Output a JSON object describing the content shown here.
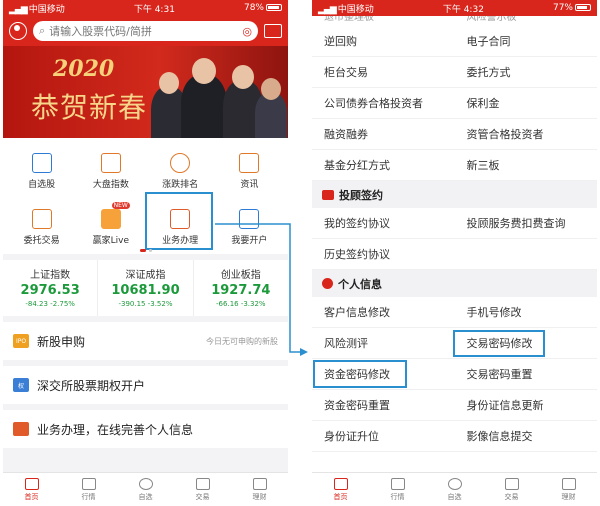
{
  "left": {
    "status": {
      "carrier": "中国移动",
      "time": "下午 4:31",
      "battery": "78%"
    },
    "search": {
      "placeholder": "请输入股票代码/简拼"
    },
    "banner": {
      "year": "2020",
      "greeting": "恭贺新春"
    },
    "grid": [
      {
        "label": "自选股",
        "icon": "chart-icon"
      },
      {
        "label": "大盘指数",
        "icon": "bar-chart-icon"
      },
      {
        "label": "涨跌排名",
        "icon": "ribbon-icon"
      },
      {
        "label": "资讯",
        "icon": "document-icon"
      },
      {
        "label": "委托交易",
        "icon": "trade-icon"
      },
      {
        "label": "赢家Live",
        "icon": "live-video-icon",
        "badge": "NEW"
      },
      {
        "label": "业务办理",
        "icon": "briefcase-icon"
      },
      {
        "label": "我要开户",
        "icon": "id-card-icon"
      }
    ],
    "indices": [
      {
        "name": "上证指数",
        "value": "2976.53",
        "change": "-84.23  -2.75%"
      },
      {
        "name": "深证成指",
        "value": "10681.90",
        "change": "-390.15  -3.52%"
      },
      {
        "name": "创业板指",
        "value": "1927.74",
        "change": "-66.16  -3.32%"
      }
    ],
    "ipo": {
      "tag": "IPO",
      "label": "新股申购",
      "note": "今日无可申购的新股"
    },
    "options": {
      "tag": "权",
      "label": "深交所股票期权开户"
    },
    "business": {
      "label": "业务办理，在线完善个人信息"
    },
    "tabs": [
      "首页",
      "行情",
      "自选",
      "交易",
      "理财"
    ]
  },
  "right": {
    "status": {
      "carrier": "中国移动",
      "time": "下午 4:32",
      "battery": "77%"
    },
    "cut_row": [
      "退市整理板",
      "风险警示板"
    ],
    "rows1": [
      [
        "逆回购",
        "电子合同"
      ],
      [
        "柜台交易",
        "委托方式"
      ],
      [
        "公司债券合格投资者",
        "保利金"
      ],
      [
        "融资融券",
        "资管合格投资者"
      ],
      [
        "基金分红方式",
        "新三板"
      ]
    ],
    "section2": "投顾签约",
    "rows2": [
      [
        "我的签约协议",
        "投顾服务费扣费查询"
      ],
      [
        "历史签约协议",
        ""
      ]
    ],
    "section3": "个人信息",
    "rows3": [
      [
        "客户信息修改",
        "手机号修改"
      ],
      [
        "风险测评",
        "交易密码修改"
      ],
      [
        "资金密码修改",
        "交易密码重置"
      ],
      [
        "资金密码重置",
        "身份证信息更新"
      ],
      [
        "身份证升位",
        "影像信息提交"
      ]
    ],
    "tabs": [
      "首页",
      "行情",
      "自选",
      "交易",
      "理财"
    ]
  },
  "colors": {
    "brand_red": "#d9261c",
    "index_green": "#1c9a3b",
    "highlight_blue": "#2a8fce"
  }
}
